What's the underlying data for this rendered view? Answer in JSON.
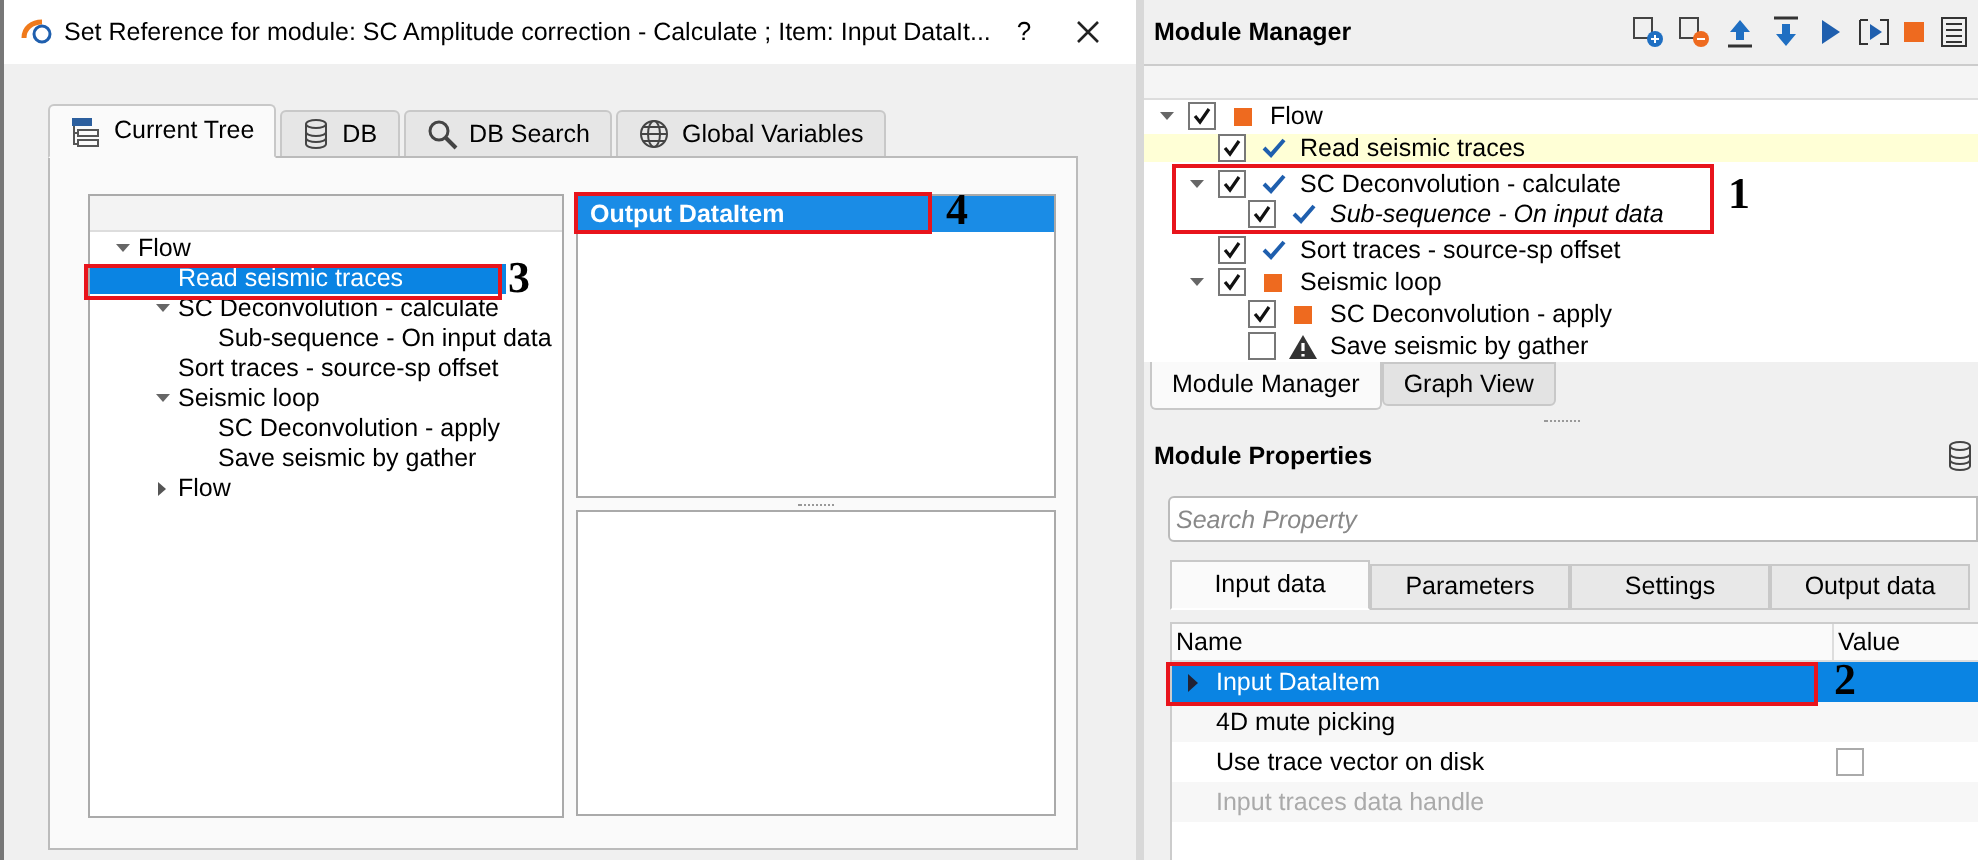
{
  "dialog": {
    "title": "Set Reference for module: SC Amplitude correction - Calculate ; Item: Input DataIt...",
    "help": "?",
    "tabs": [
      {
        "label": "Current Tree",
        "selected": true
      },
      {
        "label": "DB",
        "selected": false
      },
      {
        "label": "DB Search",
        "selected": false
      },
      {
        "label": "Global Variables",
        "selected": false
      }
    ],
    "tree": [
      {
        "label": "Flow",
        "expanded": true,
        "selected": false,
        "children": [
          {
            "label": "Read seismic traces",
            "selected": true
          },
          {
            "label": "SC Deconvolution - calculate",
            "expanded": true,
            "selected": false,
            "children": [
              {
                "label": "Sub-sequence - On input data",
                "selected": false
              }
            ]
          },
          {
            "label": "Sort traces - source-sp offset",
            "selected": false
          },
          {
            "label": "Seismic loop",
            "expanded": true,
            "selected": false,
            "children": [
              {
                "label": "SC Deconvolution - apply",
                "selected": false
              },
              {
                "label": "Save seismic by gather",
                "selected": false
              }
            ]
          },
          {
            "label": "Flow",
            "expanded": false,
            "selected": false
          }
        ]
      }
    ],
    "outputs": [
      {
        "label": "Output DataItem",
        "selected": true
      }
    ]
  },
  "module_manager": {
    "title": "Module Manager",
    "tree": [
      {
        "label": "Flow",
        "kind": "block",
        "checked": true,
        "expanded": true,
        "highlighted": false,
        "italic": false,
        "children": [
          {
            "label": "Read seismic traces",
            "kind": "check",
            "checked": true,
            "highlighted": true,
            "italic": false
          },
          {
            "label": "SC Deconvolution - calculate",
            "kind": "check",
            "checked": true,
            "expanded": true,
            "highlighted": false,
            "italic": false,
            "children": [
              {
                "label": "Sub-sequence - On input data",
                "kind": "check",
                "checked": true,
                "highlighted": false,
                "italic": true
              }
            ]
          },
          {
            "label": "Sort traces - source-sp offset",
            "kind": "check",
            "checked": true,
            "highlighted": false,
            "italic": false
          },
          {
            "label": "Seismic loop",
            "kind": "block",
            "checked": true,
            "expanded": true,
            "highlighted": false,
            "italic": false,
            "children": [
              {
                "label": "SC Deconvolution - apply",
                "kind": "block",
                "checked": true,
                "highlighted": false,
                "italic": false
              },
              {
                "label": "Save seismic by gather",
                "kind": "warning",
                "checked": false,
                "highlighted": false,
                "italic": false
              }
            ]
          }
        ]
      }
    ],
    "tabs": [
      {
        "label": "Module Manager",
        "selected": true
      },
      {
        "label": "Graph View",
        "selected": false
      }
    ]
  },
  "module_properties": {
    "title": "Module Properties",
    "search": {
      "placeholder": "Search Property"
    },
    "tabs": [
      {
        "label": "Input data",
        "selected": true
      },
      {
        "label": "Parameters",
        "selected": false
      },
      {
        "label": "Settings",
        "selected": false
      },
      {
        "label": "Output data",
        "selected": false
      }
    ],
    "columns": [
      "Name",
      "Value"
    ],
    "rows": [
      {
        "name": "Input DataItem",
        "kind": "group",
        "selected": true,
        "disabled": false
      },
      {
        "name": "4D mute picking",
        "kind": "plain",
        "selected": false,
        "disabled": false
      },
      {
        "name": "Use trace vector on disk",
        "kind": "checkbox",
        "checked": false,
        "selected": false,
        "disabled": false
      },
      {
        "name": "Input traces data handle",
        "kind": "plain",
        "selected": false,
        "disabled": true
      }
    ]
  },
  "callouts": [
    {
      "label": "1"
    },
    {
      "label": "2"
    },
    {
      "label": "3"
    },
    {
      "label": "4"
    }
  ]
}
